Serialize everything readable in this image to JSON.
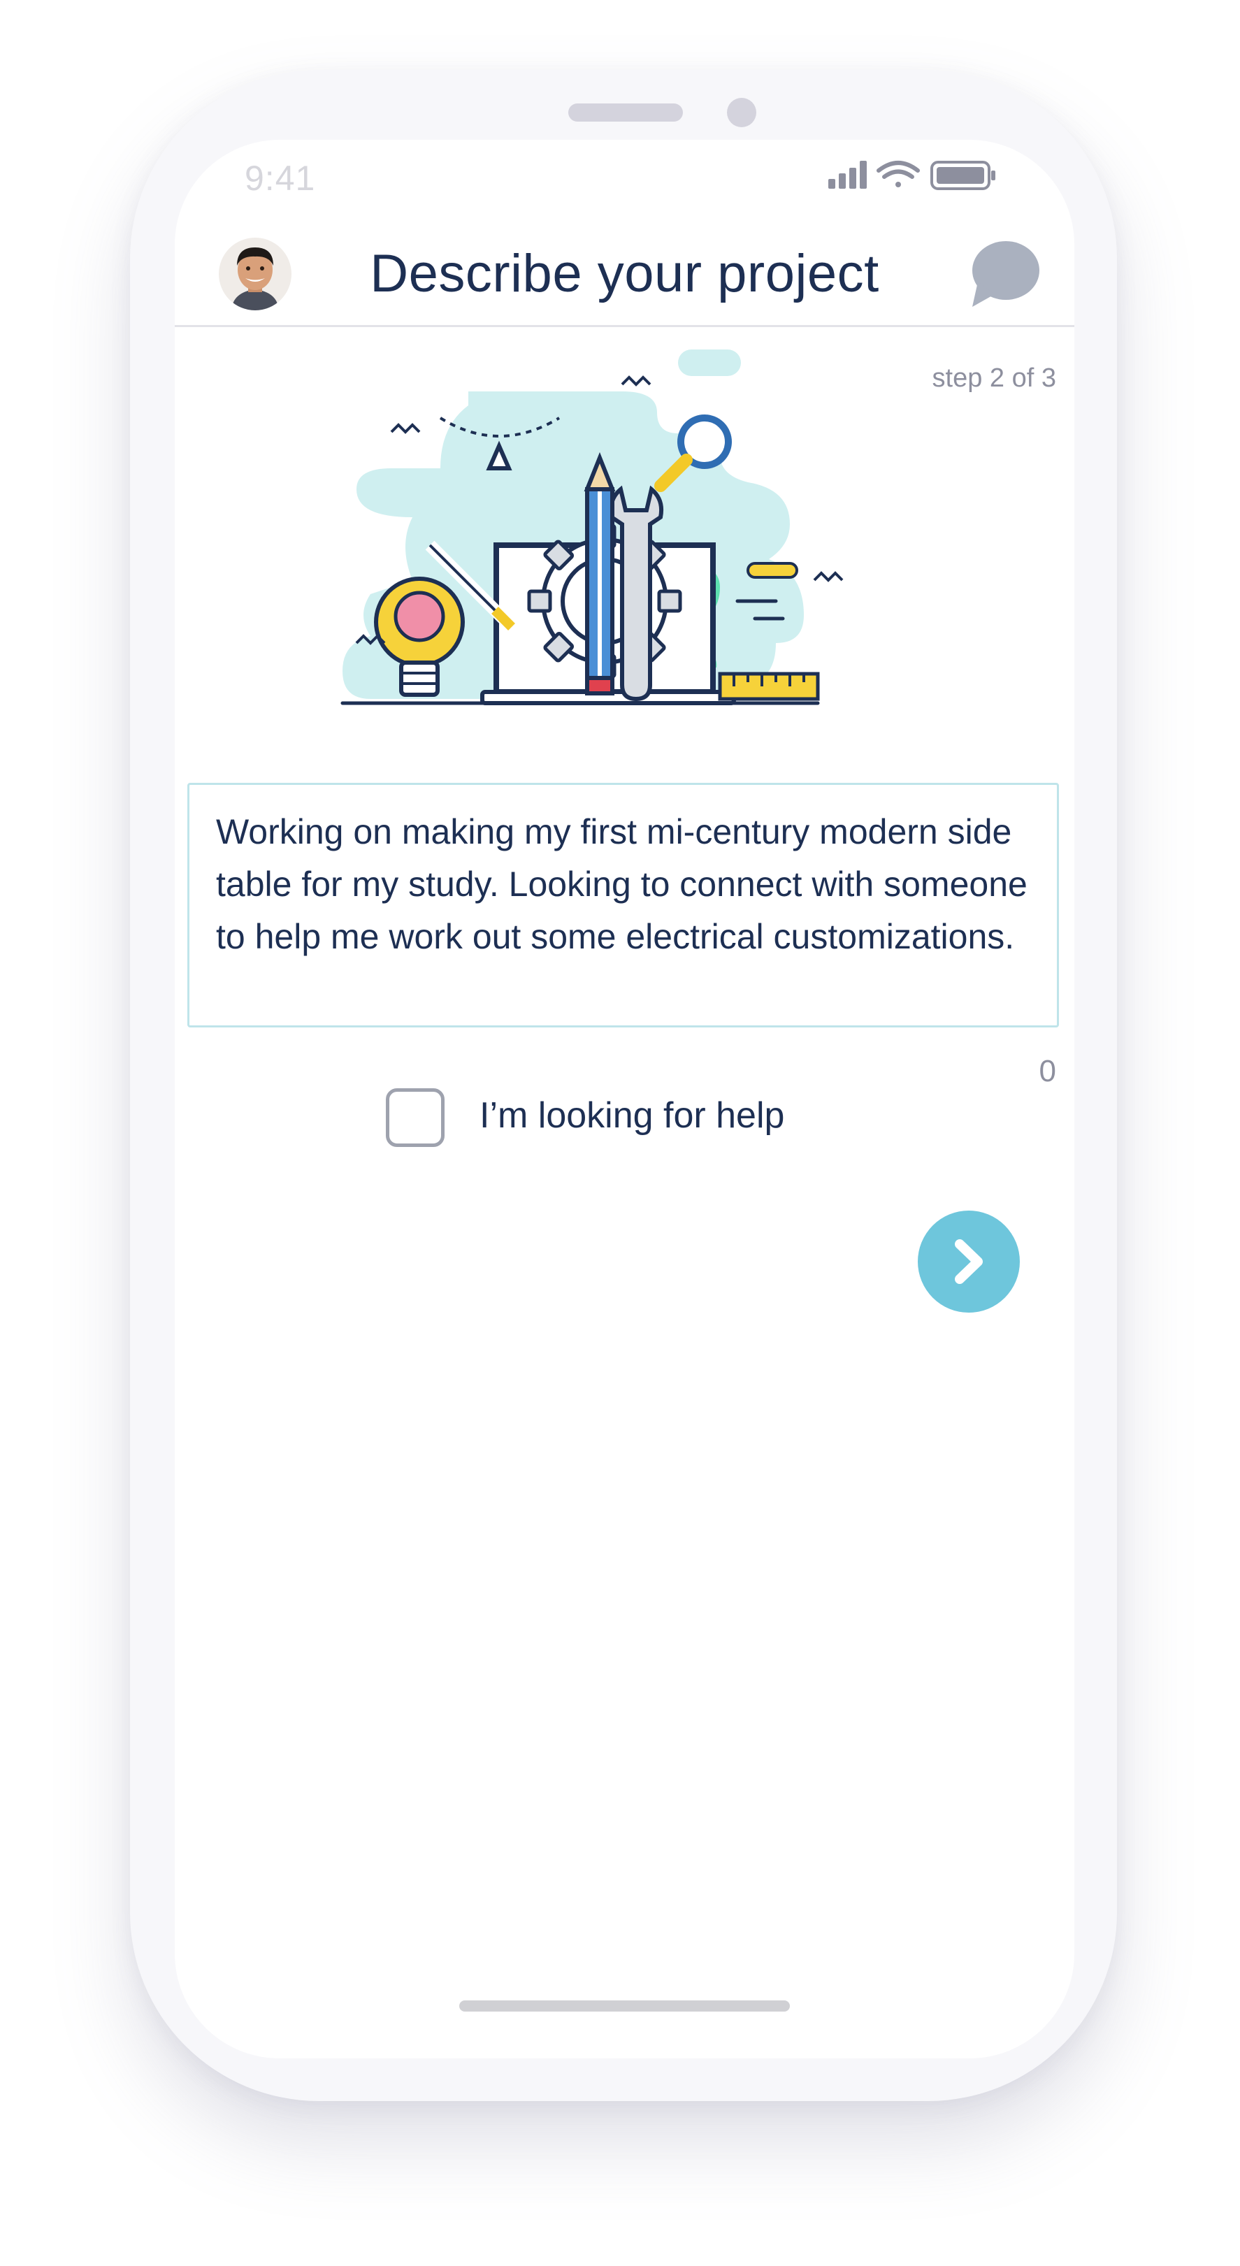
{
  "status_bar": {
    "time": "9:41"
  },
  "header": {
    "title": "Describe your project",
    "avatar_icon": "user-avatar",
    "chat_icon": "chat-bubble-icon"
  },
  "step_indicator": "step 2 of 3",
  "illustration": {
    "icon": "diy-tools-illustration"
  },
  "description": {
    "value": "Working on making my first mi-century modern side table for my study. Looking to connect with someone to help me work out some electrical customizations."
  },
  "char_counter": "0",
  "help_checkbox": {
    "label": "I’m looking for help",
    "checked": false
  },
  "next_button": {
    "icon": "chevron-right-icon"
  },
  "colors": {
    "title": "#1d2f53",
    "accent": "#6ec6dc",
    "muted": "#8d8f9e",
    "input_border": "#bfe4ea"
  }
}
